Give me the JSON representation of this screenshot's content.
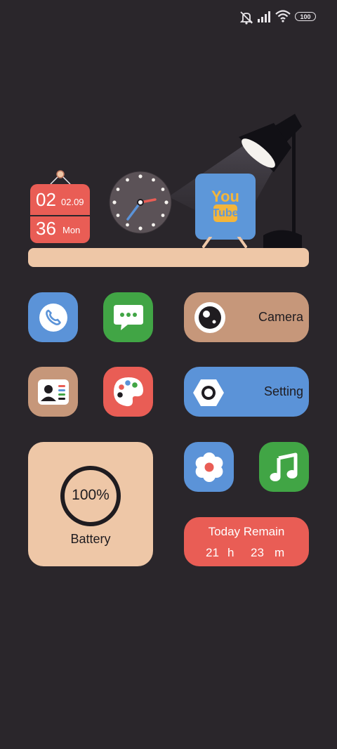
{
  "status_bar": {
    "battery_level": "100",
    "icons": [
      "mute-icon",
      "signal-icon",
      "wifi-icon",
      "battery-icon"
    ]
  },
  "calendar": {
    "hour": "02",
    "date": "02.09",
    "minute": "36",
    "day": "Mon"
  },
  "clock": {
    "hour_hand_angle_note": "analog"
  },
  "youtube": {
    "line1": "You",
    "line2": "Tube"
  },
  "apps": {
    "phone": "phone-icon",
    "messages": "messages-icon",
    "contacts": "contacts-icon",
    "themes": "themes-palette-icon",
    "gallery": "gallery-flower-icon",
    "music": "music-note-icon"
  },
  "camera_widget": {
    "label": "Camera"
  },
  "setting_widget": {
    "label": "Setting"
  },
  "battery_widget": {
    "percent": "100%",
    "label": "Battery",
    "level": 1.0
  },
  "remain_widget": {
    "title": "Today Remain",
    "hours": "21",
    "hours_unit": "h",
    "minutes": "23",
    "minutes_unit": "m"
  },
  "colors": {
    "background": "#2a262b",
    "red": "#e95d55",
    "blue": "#5b93d8",
    "green": "#41a545",
    "tan": "#c6977a",
    "peach": "#eec7a7",
    "youtube_yellow": "#f3b53b"
  }
}
